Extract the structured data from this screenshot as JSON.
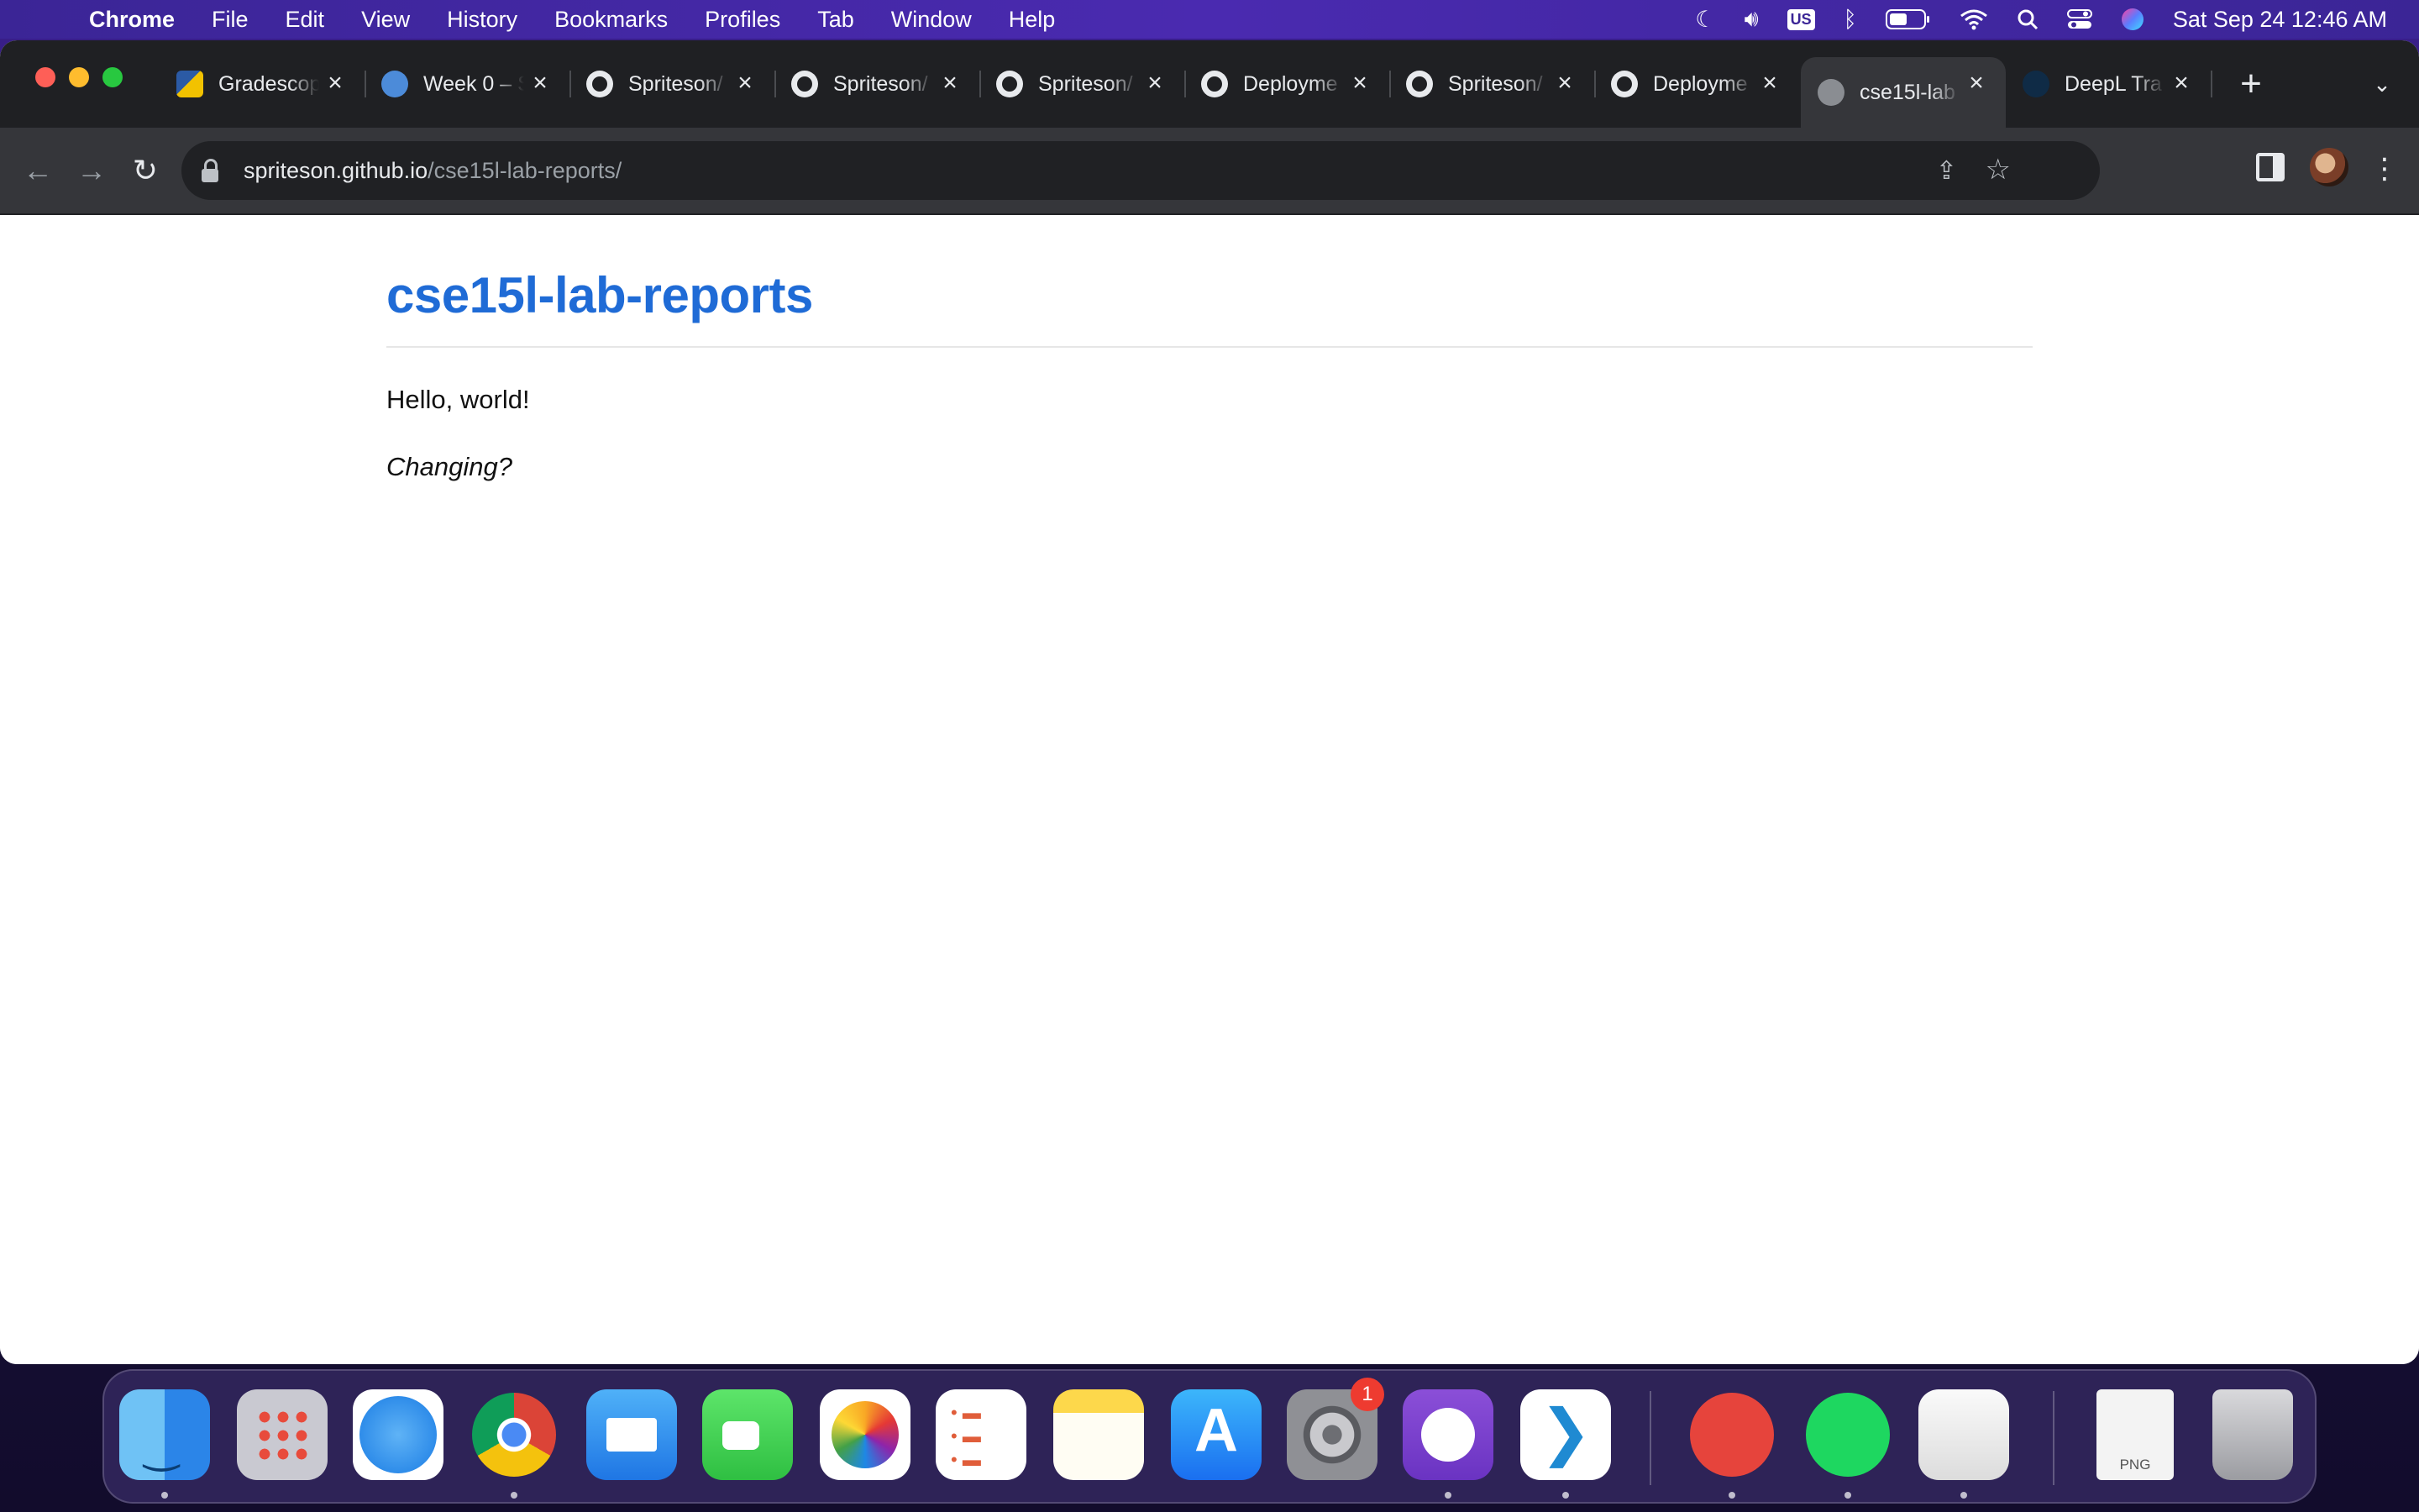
{
  "menubar": {
    "app_name": "Chrome",
    "menus": [
      "File",
      "Edit",
      "View",
      "History",
      "Bookmarks",
      "Profiles",
      "Tab",
      "Window",
      "Help"
    ],
    "input_source": "US",
    "clock": "Sat Sep 24  12:46 AM"
  },
  "browser": {
    "tabs": [
      {
        "title": "Gradescope",
        "icon": "gradescope-icon"
      },
      {
        "title": "Week 0 – S",
        "icon": "week-icon"
      },
      {
        "title": "Spriteson/",
        "icon": "github-icon"
      },
      {
        "title": "Spriteson/",
        "icon": "github-icon"
      },
      {
        "title": "Spriteson/",
        "icon": "github-icon"
      },
      {
        "title": "Deployme",
        "icon": "github-icon"
      },
      {
        "title": "Spriteson/",
        "icon": "github-icon"
      },
      {
        "title": "Deployme",
        "icon": "github-icon"
      },
      {
        "title": "cse15l-lab",
        "icon": "globe-icon",
        "active": true
      },
      {
        "title": "DeepL Tra",
        "icon": "deepl-icon"
      }
    ],
    "address": {
      "host": "spriteson.github.io",
      "path": "/cse15l-lab-reports/"
    }
  },
  "page": {
    "title": "cse15l-lab-reports",
    "paragraph": "Hello, world!",
    "emphasis": "Changing?"
  },
  "dock": {
    "apps": [
      "Finder",
      "Launchpad",
      "Safari",
      "Google Chrome",
      "Mail",
      "FaceTime",
      "Photos",
      "Reminders",
      "Notes",
      "App Store",
      "System Preferences",
      "GitHub Desktop",
      "Visual Studio Code",
      "Airmail",
      "Spotify",
      "TextEdit",
      "PNG file",
      "Trash"
    ],
    "settings_badge": "1",
    "png_label": "PNG"
  },
  "colors": {
    "page_title": "#1f6bd6",
    "tabstrip": "#1f2023",
    "toolbar": "#35363a"
  }
}
